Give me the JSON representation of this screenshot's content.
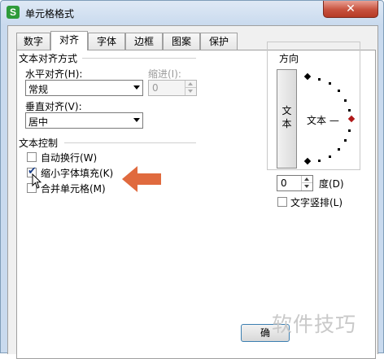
{
  "window": {
    "title": "单元格格式",
    "app_icon_glyph": "S",
    "close_glyph": "✕",
    "accent": "#c7513d"
  },
  "tabs": [
    {
      "label": "数字",
      "active": false
    },
    {
      "label": "对齐",
      "active": true
    },
    {
      "label": "字体",
      "active": false
    },
    {
      "label": "边框",
      "active": false
    },
    {
      "label": "图案",
      "active": false
    },
    {
      "label": "保护",
      "active": false
    }
  ],
  "alignment": {
    "group_title": "文本对齐方式",
    "horizontal_label": "水平对齐(H):",
    "horizontal_value": "常规",
    "indent_label": "缩进(I):",
    "indent_value": "0",
    "vertical_label": "垂直对齐(V):",
    "vertical_value": "居中"
  },
  "text_control": {
    "group_title": "文本控制",
    "wrap_label": "自动换行(W)",
    "wrap_checked": false,
    "shrink_label": "缩小字体填充(K)",
    "shrink_checked": true,
    "merge_label": "合并单元格(M)",
    "merge_checked": false
  },
  "orientation": {
    "group_title": "方向",
    "vertical_text_label": "文本",
    "dial_label": "文本 —",
    "degree_value": "0",
    "degree_label": "度(D)",
    "stack_label": "文字竖排(L)",
    "stack_checked": false
  },
  "footer": {
    "ok_label": "确"
  },
  "annotation": {
    "arrow_color": "#e06a3e"
  },
  "watermark": "软件技巧"
}
